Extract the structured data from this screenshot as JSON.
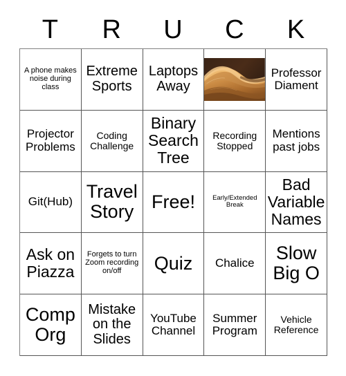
{
  "card": {
    "title_letters": [
      "T",
      "R",
      "U",
      "C",
      "K"
    ],
    "free_space_label": "Free!",
    "colors": {
      "border": "#555555",
      "text": "#000000",
      "background": "#ffffff",
      "image_sand_light": "#e8ae62",
      "image_sand_mid": "#c4803a",
      "image_sand_dark": "#8a5424",
      "image_shadow": "#3a2316"
    },
    "rows": [
      [
        {
          "type": "text",
          "label": "A phone makes noise during class",
          "size": "xs"
        },
        {
          "type": "text",
          "label": "Extreme Sports",
          "size": "lg"
        },
        {
          "type": "text",
          "label": "Laptops Away",
          "size": "lg"
        },
        {
          "type": "image",
          "label": "desert-sand-dunes",
          "size": "md"
        },
        {
          "type": "text",
          "label": "Professor Diament",
          "size": "md"
        }
      ],
      [
        {
          "type": "text",
          "label": "Projector Problems",
          "size": "md"
        },
        {
          "type": "text",
          "label": "Coding Challenge",
          "size": "sm"
        },
        {
          "type": "text",
          "label": "Binary Search Tree",
          "size": "xl"
        },
        {
          "type": "text",
          "label": "Recording Stopped",
          "size": "sm"
        },
        {
          "type": "text",
          "label": "Mentions past jobs",
          "size": "md"
        }
      ],
      [
        {
          "type": "text",
          "label": "Git(Hub)",
          "size": "md"
        },
        {
          "type": "text",
          "label": "Travel Story",
          "size": "xxl"
        },
        {
          "type": "text",
          "label": "Free!",
          "size": "xxl"
        },
        {
          "type": "text",
          "label": "Early/Extended Break",
          "size": "xxs"
        },
        {
          "type": "text",
          "label": "Bad Variable Names",
          "size": "xl"
        }
      ],
      [
        {
          "type": "text",
          "label": "Ask on Piazza",
          "size": "xl"
        },
        {
          "type": "text",
          "label": "Forgets to turn Zoom recording on/off",
          "size": "xs"
        },
        {
          "type": "text",
          "label": "Quiz",
          "size": "xxl"
        },
        {
          "type": "text",
          "label": "Chalice",
          "size": "md"
        },
        {
          "type": "text",
          "label": "Slow Big O",
          "size": "xxl"
        }
      ],
      [
        {
          "type": "text",
          "label": "Comp Org",
          "size": "xxl"
        },
        {
          "type": "text",
          "label": "Mistake on the Slides",
          "size": "lg"
        },
        {
          "type": "text",
          "label": "YouTube Channel",
          "size": "md"
        },
        {
          "type": "text",
          "label": "Summer Program",
          "size": "md"
        },
        {
          "type": "text",
          "label": "Vehicle Reference",
          "size": "sm"
        }
      ]
    ]
  }
}
